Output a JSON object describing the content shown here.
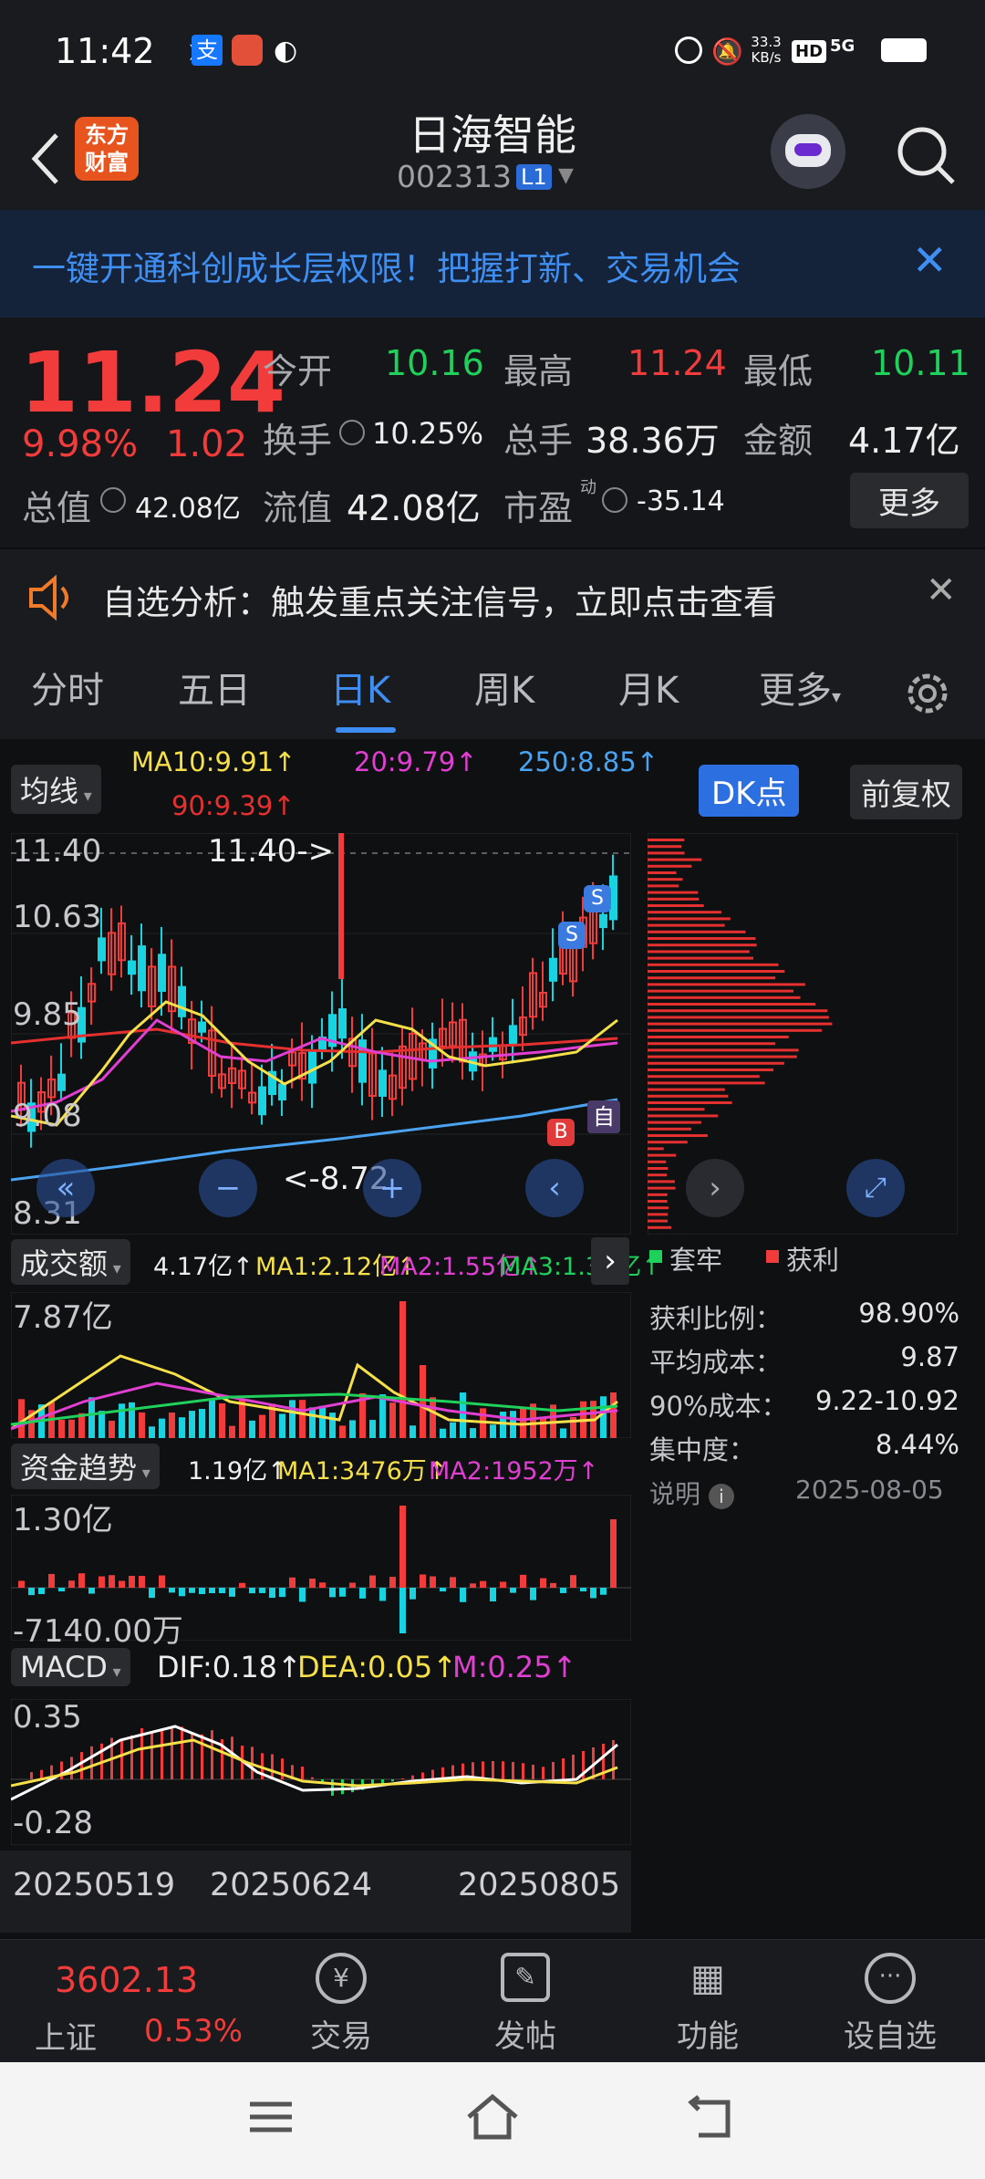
{
  "status_bar": {
    "time": "11:42",
    "net_speed": "33.3\nKB/s",
    "net_speed_top": "33.3",
    "net_speed_bottom": "KB/s",
    "hd": "HD",
    "signal": "5G"
  },
  "header": {
    "title": "日海智能",
    "code": "002313",
    "level_badge": "L1",
    "logo_text_1": "东方",
    "logo_text_2": "财富"
  },
  "banner": {
    "text": "一键开通科创成长层权限！把握打新、交易机会"
  },
  "quote": {
    "price": "11.24",
    "change_pct": "9.98%",
    "change": "1.02",
    "open_label": "今开",
    "open": "10.16",
    "high_label": "最高",
    "high": "11.24",
    "low_label": "最低",
    "low": "10.11",
    "turnover_label": "换手",
    "turnover": "10.25%",
    "volume_label": "总手",
    "volume": "38.36万",
    "amount_label": "金额",
    "amount": "4.17亿",
    "mcap_label": "总值",
    "mcap": "42.08亿",
    "float_label": "流值",
    "float": "42.08亿",
    "pe_label": "市盈",
    "pe_sup": "动",
    "pe": "-35.14",
    "more": "更多"
  },
  "signal": {
    "text": "自选分析：触发重点关注信号，立即点击查看"
  },
  "tabs": [
    "分时",
    "五日",
    "日K",
    "周K",
    "月K",
    "更多"
  ],
  "kline": {
    "ma_selector": "均线",
    "ma10": "MA10:9.91↑",
    "ma20": "20:9.79↑",
    "ma250": "250:8.85↑",
    "ma90": "90:9.39↑",
    "dk_button": "DK点",
    "adjust_button": "前复权",
    "y_labels": [
      "11.40",
      "10.63",
      "9.85",
      "9.08",
      "8.31"
    ],
    "high_marker": "11.40->",
    "low_marker": "<-8.72",
    "self_tag": "自",
    "ma_colors": {
      "ma10": "#f5e04a",
      "ma20": "#e13fd2",
      "ma90": "#e53030",
      "ma250": "#4aa3f0"
    }
  },
  "volume": {
    "selector": "成交额",
    "value": "4.17亿↑",
    "ma1": "MA1:2.12亿↑",
    "ma2": "MA2:1.55亿↑",
    "ma3": "MA3:1.31亿↑",
    "y_label": "7.87亿"
  },
  "fund": {
    "selector": "资金趋势",
    "value": "1.19亿↑",
    "ma1": "MA1:3476万↑",
    "ma2": "MA2:1952万↑",
    "y_top": "1.30亿",
    "y_bottom": "-7140.00万"
  },
  "macd": {
    "selector": "MACD",
    "dif": "DIF:0.18↑",
    "dea": "DEA:0.05↑",
    "m": "M:0.25↑",
    "y_top": "0.35",
    "y_bottom": "-0.28"
  },
  "dates": [
    "20250519",
    "20250624",
    "20250805"
  ],
  "chip": {
    "legend_trapped": "套牢",
    "legend_profit": "获利",
    "rows": [
      {
        "label": "获利比例：",
        "value": "98.90%"
      },
      {
        "label": "平均成本：",
        "value": "9.87"
      },
      {
        "label": "90%成本：",
        "value": "9.22-10.92"
      },
      {
        "label": "集中度：",
        "value": "8.44%"
      }
    ],
    "note": "说明",
    "date": "2025-08-05"
  },
  "bottom_nav": {
    "index_value": "3602.13",
    "index_name": "上证",
    "index_change": "0.53%",
    "items": [
      "交易",
      "发帖",
      "功能",
      "设自选"
    ]
  }
}
